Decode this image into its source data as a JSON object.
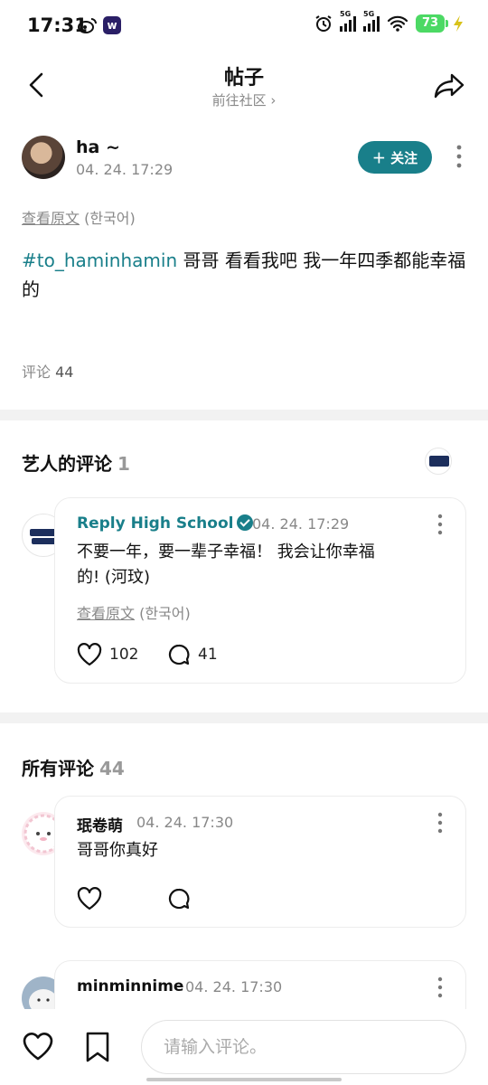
{
  "status_bar": {
    "time": "17:31",
    "weibo_icon": "weibo-icon",
    "app_icon_letter": "w",
    "signal_1_label": "5G",
    "signal_2_label": "5G",
    "battery": "73",
    "battery_color": "#4cd964"
  },
  "header": {
    "title": "帖子",
    "subtitle": "前往社区 ›"
  },
  "post": {
    "author": "ha ~",
    "time": "04. 24. 17:29",
    "follow_label": "＋ 关注",
    "view_original_link": "查看原文",
    "view_original_lang": " (한국어)",
    "hashtag": "#to_haminhamin",
    "body": " 哥哥 看看我吧 我一年四季都能幸福的",
    "comment_label": "评论",
    "comment_count": "44"
  },
  "artist_section": {
    "title": "艺人的评论",
    "count": "1",
    "comment": {
      "author": "Reply High School",
      "time": "04. 24. 17:29",
      "text_line1": "不要一年，要一辈子幸福！ 我会让你幸福",
      "text_line2": "的! (河玟)",
      "view_original_link": "查看原文",
      "view_original_lang": " (한국어)",
      "likes": "102",
      "replies": "41"
    }
  },
  "all_section": {
    "title": "所有评论",
    "count": "44",
    "comments": [
      {
        "author": "珉卷萌",
        "time": "04. 24. 17:30",
        "text": "哥哥你真好"
      },
      {
        "author": "minminnime",
        "time": "04. 24. 17:30",
        "text": ""
      }
    ]
  },
  "bottom_bar": {
    "input_placeholder": "请输入评论。"
  },
  "colors": {
    "accent": "#197f8a",
    "muted_text": "#888888",
    "divider": "#f2f2f2"
  }
}
